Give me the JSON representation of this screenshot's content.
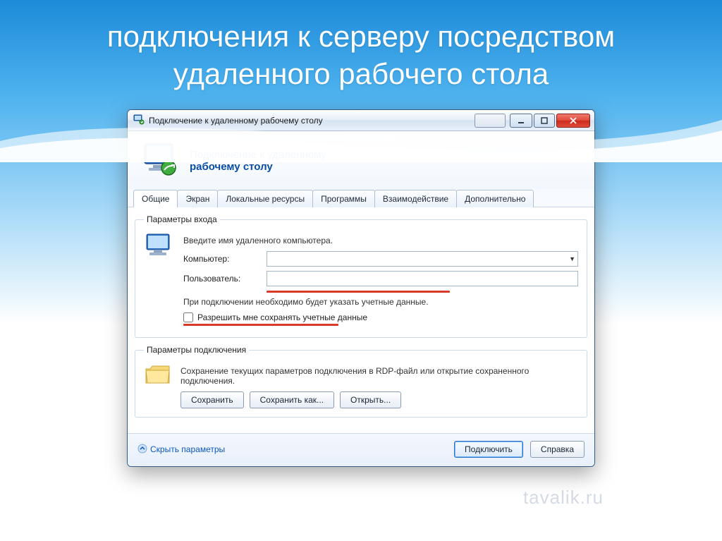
{
  "slide": {
    "title": "подключения к серверу посредством удаленного рабочего стола"
  },
  "window": {
    "title": "Подключение к удаленному рабочему столу"
  },
  "header": {
    "line1": "Подключение к удаленному",
    "line2": "рабочему столу"
  },
  "tabs": [
    {
      "label": "Общие",
      "active": true
    },
    {
      "label": "Экран",
      "active": false
    },
    {
      "label": "Локальные ресурсы",
      "active": false
    },
    {
      "label": "Программы",
      "active": false
    },
    {
      "label": "Взаимодействие",
      "active": false
    },
    {
      "label": "Дополнительно",
      "active": false
    }
  ],
  "login": {
    "legend": "Параметры входа",
    "instruction": "Введите имя удаленного компьютера.",
    "computer_label": "Компьютер:",
    "computer_value": "",
    "user_label": "Пользователь:",
    "user_value": "",
    "note": "При подключении необходимо будет указать учетные данные.",
    "save_creds_label": "Разрешить мне сохранять учетные данные"
  },
  "connParams": {
    "legend": "Параметры подключения",
    "desc": "Сохранение текущих параметров подключения в RDP-файл или открытие сохраненного подключения.",
    "save": "Сохранить",
    "save_as": "Сохранить как...",
    "open": "Открыть..."
  },
  "footer": {
    "hide_options": "Скрыть параметры",
    "connect": "Подключить",
    "help": "Справка"
  },
  "watermark": "tavalik.ru"
}
